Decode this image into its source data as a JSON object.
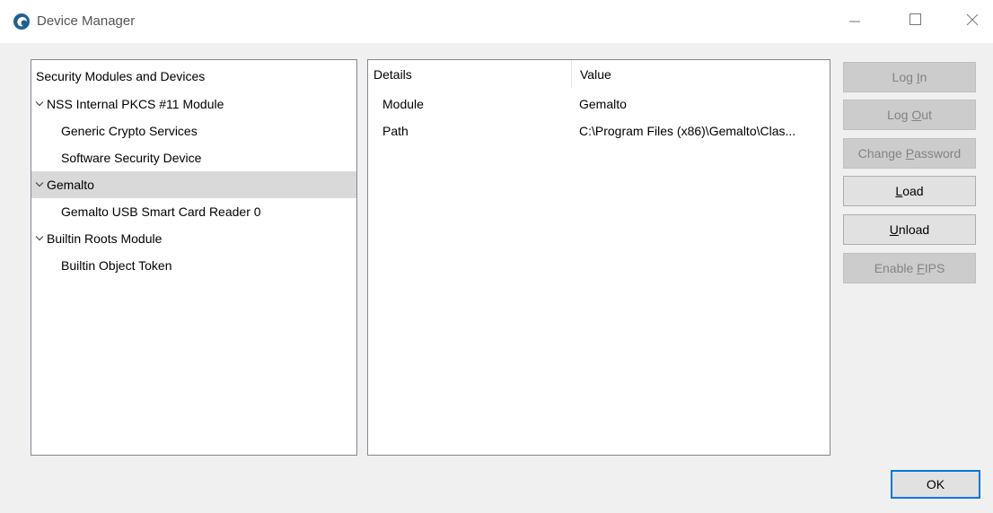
{
  "window": {
    "title": "Device Manager",
    "app_icon": "thunderbird-icon",
    "controls": [
      "minimize-icon",
      "maximize-icon",
      "close-icon"
    ]
  },
  "tree": {
    "header": "Security Modules and Devices",
    "items": [
      {
        "label": "NSS Internal PKCS #11 Module",
        "level": 0,
        "expanded": true,
        "selected": false
      },
      {
        "label": "Generic Crypto Services",
        "level": 1,
        "selected": false
      },
      {
        "label": "Software Security Device",
        "level": 1,
        "selected": false
      },
      {
        "label": "Gemalto",
        "level": 0,
        "expanded": true,
        "selected": true
      },
      {
        "label": "Gemalto USB Smart Card Reader 0",
        "level": 1,
        "selected": false
      },
      {
        "label": "Builtin Roots Module",
        "level": 0,
        "expanded": true,
        "selected": false
      },
      {
        "label": "Builtin Object Token",
        "level": 1,
        "selected": false
      }
    ]
  },
  "details": {
    "columns": [
      "Details",
      "Value"
    ],
    "rows": [
      {
        "key": "Module",
        "value": "Gemalto"
      },
      {
        "key": "Path",
        "value": "C:\\Program Files (x86)\\Gemalto\\Clas..."
      }
    ]
  },
  "buttons": {
    "log_in": {
      "pre": "Log ",
      "accel": "I",
      "post": "n",
      "enabled": false
    },
    "log_out": {
      "pre": "Log ",
      "accel": "O",
      "post": "ut",
      "enabled": false
    },
    "change_password": {
      "pre": "Change ",
      "accel": "P",
      "post": "assword",
      "enabled": false
    },
    "load": {
      "pre": "",
      "accel": "L",
      "post": "oad",
      "enabled": true
    },
    "unload": {
      "pre": "",
      "accel": "U",
      "post": "nload",
      "enabled": true
    },
    "enable_fips": {
      "pre": "Enable ",
      "accel": "F",
      "post": "IPS",
      "enabled": false
    },
    "ok": "OK"
  },
  "colors": {
    "selection": "#d9d9d9",
    "ok_border": "#0078d7",
    "disabled_text": "#838383"
  }
}
